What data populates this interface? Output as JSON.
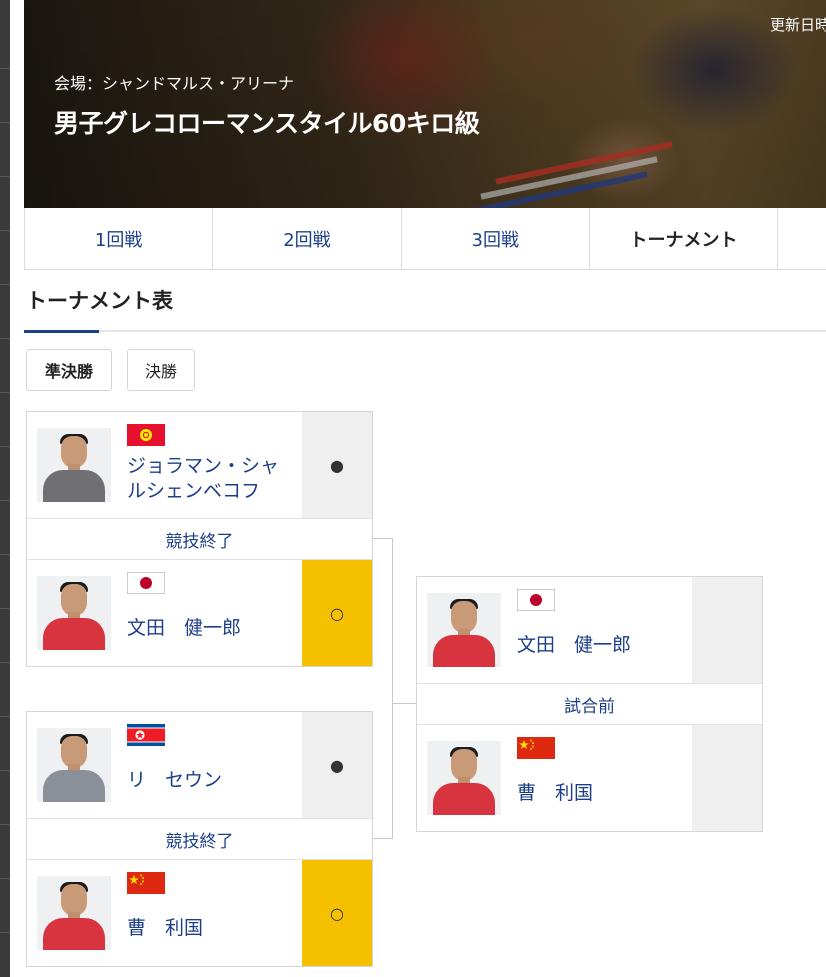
{
  "hero": {
    "venue_label": "会場：",
    "venue_name": "シャンドマルス・アリーナ",
    "title": "男子グレコローマンスタイル60キロ級",
    "updated_label": "更新日時"
  },
  "tabs": [
    {
      "label": "1回戦",
      "active": false
    },
    {
      "label": "2回戦",
      "active": false
    },
    {
      "label": "3回戦",
      "active": false
    },
    {
      "label": "トーナメント",
      "active": true
    }
  ],
  "section": {
    "title": "トーナメント表"
  },
  "round_buttons": [
    {
      "label": "準決勝",
      "active": true
    },
    {
      "label": "決勝",
      "active": false
    }
  ],
  "semifinals": [
    {
      "status": "競技終了",
      "top": {
        "name": "ジョラマン・シャルシェンベコフ",
        "country": "kyrgyzstan",
        "flag_icon": "kyrgyzstan-flag-icon",
        "result_mark": "●",
        "winner": false
      },
      "bottom": {
        "name": "文田　健一郎",
        "country": "japan",
        "flag_icon": "japan-flag-icon",
        "result_mark": "○",
        "winner": true
      }
    },
    {
      "status": "競技終了",
      "top": {
        "name": "リ　セウン",
        "country": "north-korea",
        "flag_icon": "north-korea-flag-icon",
        "result_mark": "●",
        "winner": false
      },
      "bottom": {
        "name": "曹　利国",
        "country": "china",
        "flag_icon": "china-flag-icon",
        "result_mark": "○",
        "winner": true
      }
    }
  ],
  "final": {
    "status": "試合前",
    "top": {
      "name": "文田　健一郎",
      "country": "japan",
      "flag_icon": "japan-flag-icon",
      "result_mark": ""
    },
    "bottom": {
      "name": "曹　利国",
      "country": "china",
      "flag_icon": "china-flag-icon",
      "result_mark": ""
    }
  },
  "colors": {
    "accent_navy": "#1d3f8a",
    "winner_yellow": "#f5c000",
    "neutral_gray": "#efefef"
  }
}
